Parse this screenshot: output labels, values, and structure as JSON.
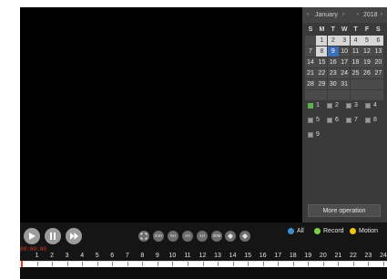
{
  "calendar": {
    "month": "January",
    "year": "2018",
    "weekdays": [
      "S",
      "M",
      "T",
      "W",
      "T",
      "F",
      "S"
    ],
    "weeks": [
      [
        "",
        "1",
        "2",
        "3",
        "4",
        "5",
        "6"
      ],
      [
        "7",
        "8",
        "9",
        "10",
        "11",
        "12",
        "13"
      ],
      [
        "14",
        "15",
        "16",
        "17",
        "18",
        "19",
        "20"
      ],
      [
        "21",
        "22",
        "23",
        "24",
        "25",
        "26",
        "27"
      ],
      [
        "28",
        "29",
        "30",
        "31",
        "",
        "",
        ""
      ],
      [
        "",
        "",
        "",
        "",
        "",
        "",
        ""
      ]
    ],
    "selected_day": "9",
    "marked_days": [
      "1",
      "2",
      "3",
      "4",
      "5",
      "6",
      "8"
    ]
  },
  "channels": [
    "1",
    "2",
    "3",
    "4",
    "5",
    "6",
    "7",
    "8",
    "9"
  ],
  "checked_channels": [
    "1"
  ],
  "more_operation": "More operation",
  "speed_buttons": [
    "24H",
    "6H",
    "2H",
    "1H",
    "30M"
  ],
  "filters": {
    "all": {
      "label": "All",
      "color": "#3d8fd1"
    },
    "record": {
      "label": "Record",
      "color": "#7ad04a"
    },
    "motion": {
      "label": "Motion",
      "color": "#f1c40f"
    }
  },
  "time_readout": "00:00:00",
  "hours": [
    "1",
    "2",
    "3",
    "4",
    "5",
    "6",
    "7",
    "8",
    "9",
    "10",
    "11",
    "12",
    "13",
    "14",
    "15",
    "16",
    "17",
    "18",
    "19",
    "20",
    "21",
    "22",
    "23",
    "24"
  ]
}
